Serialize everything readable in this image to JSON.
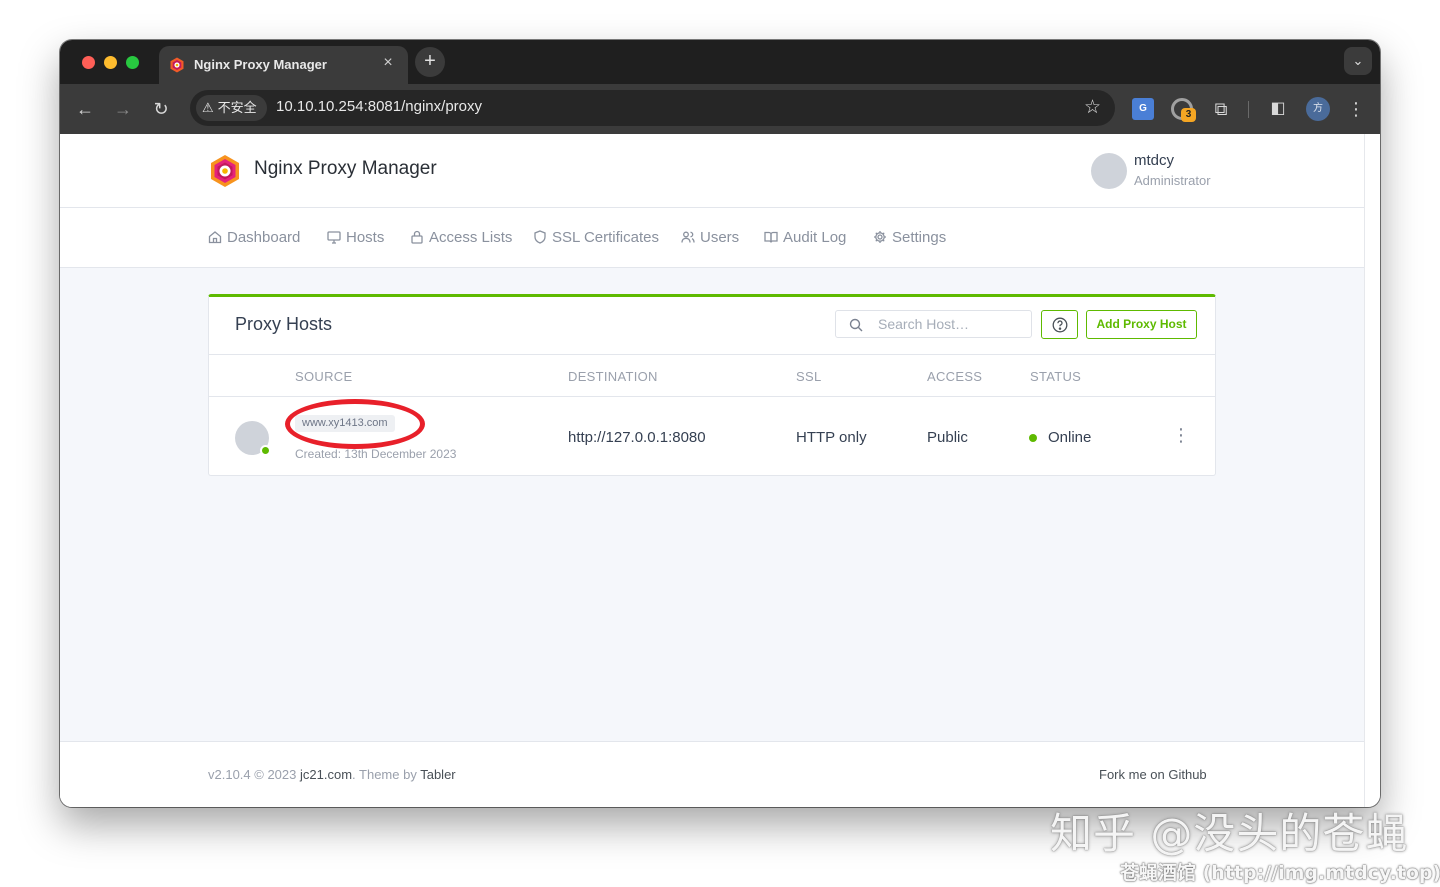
{
  "browser": {
    "tab_title": "Nginx Proxy Manager",
    "tab_close": "×",
    "new_tab": "+",
    "tab_menu": "⌄",
    "security_label": "不安全",
    "url": "10.10.10.254:8081/nginx/proxy",
    "extension_badge": "3",
    "translate_label": "G",
    "profile_initial": "方"
  },
  "app": {
    "brand": "Nginx Proxy Manager",
    "user": {
      "name": "mtdcy",
      "role": "Administrator"
    },
    "nav": [
      {
        "label": "Dashboard",
        "icon": "home-icon"
      },
      {
        "label": "Hosts",
        "icon": "monitor-icon"
      },
      {
        "label": "Access Lists",
        "icon": "lock-icon"
      },
      {
        "label": "SSL Certificates",
        "icon": "shield-icon"
      },
      {
        "label": "Users",
        "icon": "users-icon"
      },
      {
        "label": "Audit Log",
        "icon": "book-icon"
      },
      {
        "label": "Settings",
        "icon": "gear-icon"
      }
    ]
  },
  "card": {
    "title": "Proxy Hosts",
    "search_placeholder": "Search Host…",
    "add_button": "Add Proxy Host",
    "columns": [
      "SOURCE",
      "DESTINATION",
      "SSL",
      "ACCESS",
      "STATUS"
    ],
    "rows": [
      {
        "domain": "www.xy1413.com",
        "created": "Created: 13th December 2023",
        "destination": "http://127.0.0.1:8080",
        "ssl": "HTTP only",
        "access": "Public",
        "status": "Online"
      }
    ]
  },
  "footer": {
    "version": "v2.10.4 © 2023",
    "author_link": "jc21.com",
    "theme_text": ". Theme by",
    "theme_link": "Tabler",
    "github": "Fork me on Github"
  },
  "watermark": {
    "line1": "知乎 @没头的苍蝇",
    "line2": "苍蝇酒馆 (http://img.mtdcy.top)"
  },
  "colors": {
    "accent": "#5eba00",
    "highlight_ring": "#e8202a",
    "browser_chrome": "#3b3b3b"
  }
}
